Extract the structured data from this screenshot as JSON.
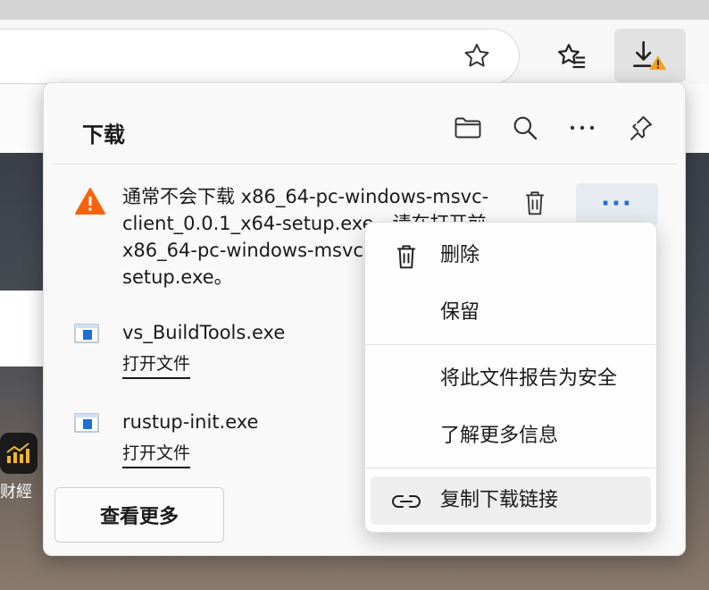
{
  "flyout": {
    "title": "下载",
    "header_icons": [
      "folder-icon",
      "search-icon",
      "more-icon",
      "pin-icon"
    ],
    "warning_item": {
      "lines": [
        "通常不会下载 x86_64-pc-windows-msvc-",
        "client_0.0.1_x64-setup.exe。请在打开前",
        "x86_64-pc-windows-msvc-",
        "setup.exe。"
      ],
      "more_label": "···"
    },
    "files": [
      {
        "name": "vs_BuildTools.exe",
        "action": "打开文件"
      },
      {
        "name": "rustup-init.exe",
        "action": "打开文件"
      }
    ],
    "see_more": "查看更多"
  },
  "context_menu": {
    "delete": "删除",
    "keep": "保留",
    "report_safe": "将此文件报告为安全",
    "learn_more": "了解更多信息",
    "copy_link": "复制下载链接"
  },
  "page": {
    "finance_caption": "财經"
  },
  "colors": {
    "warning": "#f7630c",
    "accent": "#1f6fd1"
  }
}
